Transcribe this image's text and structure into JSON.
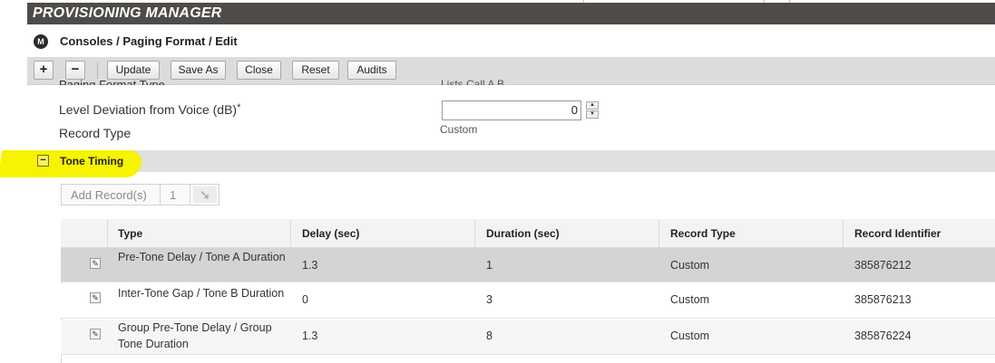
{
  "app": {
    "title": "PROVISIONING MANAGER"
  },
  "breadcrumb": {
    "text": "Consoles / Paging Format / Edit"
  },
  "toolbar": {
    "add_icon": "+",
    "remove_icon": "−",
    "update_label": "Update",
    "save_as_label": "Save As",
    "close_label": "Close",
    "reset_label": "Reset",
    "audits_label": "Audits"
  },
  "form": {
    "cut_off_label": "Paging Format Type",
    "cut_off_value": "Lists Call A B",
    "level_deviation": {
      "label": "Level Deviation from Voice (dB)",
      "required_mark": "*",
      "value": "0"
    },
    "record_type": {
      "label": "Record Type",
      "value": "Custom"
    }
  },
  "section": {
    "title": "Tone Timing",
    "collapse_icon": "−",
    "highlight_color": "#f6f400"
  },
  "add_records": {
    "label": "Add Record(s)",
    "count": "1",
    "go_icon": "arrow-down-right-icon"
  },
  "table": {
    "columns": [
      "Type",
      "Delay (sec)",
      "Duration (sec)",
      "Record Type",
      "Record Identifier"
    ],
    "rows": [
      {
        "type": "Pre-Tone Delay / Tone A Duration",
        "delay": "1.3",
        "duration": "1",
        "record_type": "Custom",
        "record_id": "385876212",
        "selected": true
      },
      {
        "type": "Inter-Tone Gap / Tone B Duration",
        "delay": "0",
        "duration": "3",
        "record_type": "Custom",
        "record_id": "385876213",
        "selected": false
      },
      {
        "type": "Group Pre-Tone Delay / Group Tone Duration",
        "delay": "1.3",
        "duration": "8",
        "record_type": "Custom",
        "record_id": "385876224",
        "selected": false
      }
    ]
  },
  "colors": {
    "header_bg": "#4e4b48",
    "toolbar_bg": "#dcdcdc",
    "selected_row_bg": "#d4d4d4"
  }
}
